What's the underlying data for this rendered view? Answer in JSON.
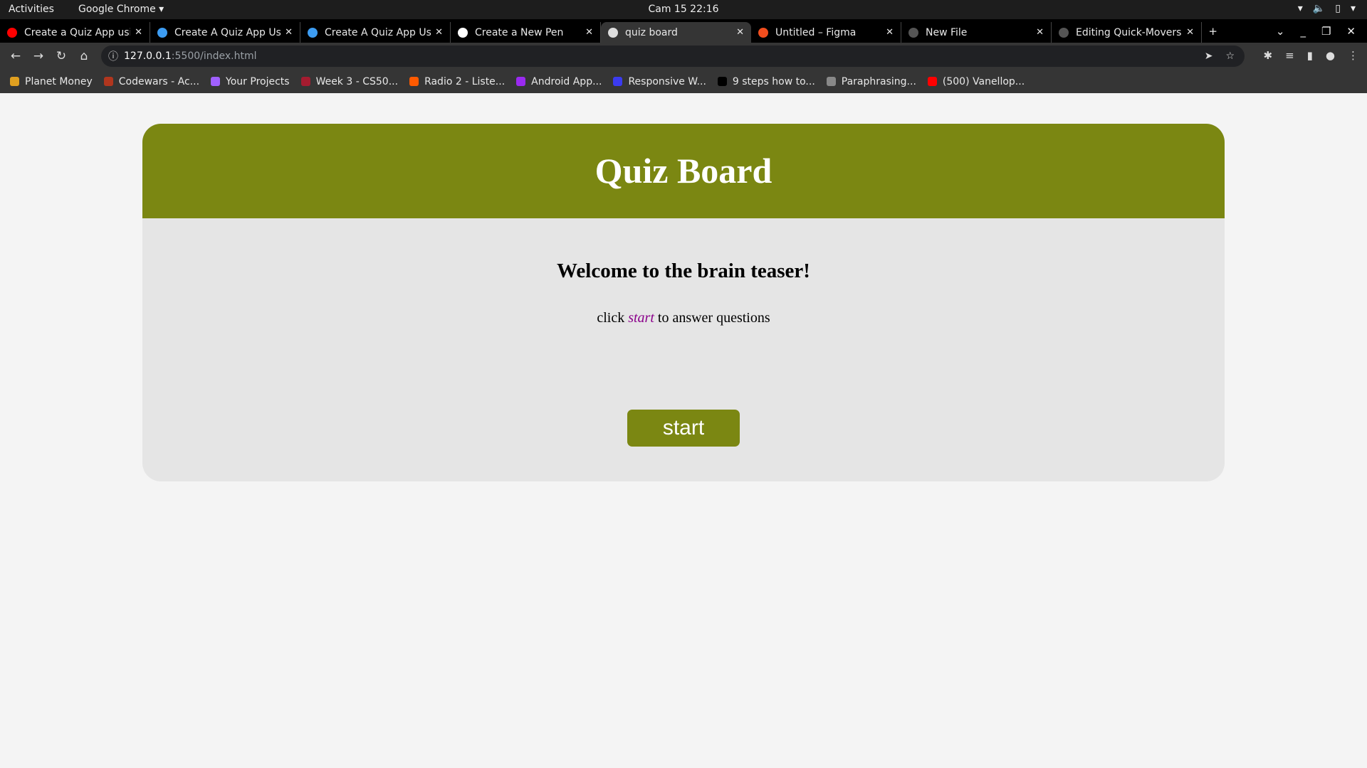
{
  "os": {
    "activities": "Activities",
    "app": "Google Chrome ▾",
    "clock": "Cam 15  22:16"
  },
  "tabs": [
    {
      "title": "Create a Quiz App using",
      "color": "#ff0000"
    },
    {
      "title": "Create A Quiz App Using",
      "color": "#3d9df3"
    },
    {
      "title": "Create A Quiz App Using",
      "color": "#3d9df3"
    },
    {
      "title": "Create a New Pen",
      "color": "#ffffff"
    },
    {
      "title": "quiz board",
      "color": "#dddddd"
    },
    {
      "title": "Untitled – Figma",
      "color": "#f24e1e"
    },
    {
      "title": "New File",
      "color": "#555555"
    },
    {
      "title": "Editing Quick-Movers",
      "color": "#555555"
    }
  ],
  "address": {
    "host": "127.0.0.1",
    "path": ":5500/index.html"
  },
  "bookmarks": [
    {
      "label": "Planet Money",
      "color": "#e0a020"
    },
    {
      "label": "Codewars - Ac...",
      "color": "#b1361e"
    },
    {
      "label": "Your Projects",
      "color": "#a060ff"
    },
    {
      "label": "Week 3 - CS50...",
      "color": "#a51c30"
    },
    {
      "label": "Radio 2 - Liste...",
      "color": "#ff5a00"
    },
    {
      "label": "Android App...",
      "color": "#9a2af0"
    },
    {
      "label": "Responsive W...",
      "color": "#3b3bf0"
    },
    {
      "label": "9 steps how to...",
      "color": "#000000"
    },
    {
      "label": "Paraphrasing...",
      "color": "#888888"
    },
    {
      "label": "(500) Vanellop...",
      "color": "#ff0000"
    }
  ],
  "page": {
    "title": "Quiz Board",
    "welcome": "Welcome to the brain teaser!",
    "instr_pre": "click ",
    "instr_em": "start",
    "instr_post": " to answer questions",
    "start_label": "start",
    "accent": "#7b8712"
  }
}
